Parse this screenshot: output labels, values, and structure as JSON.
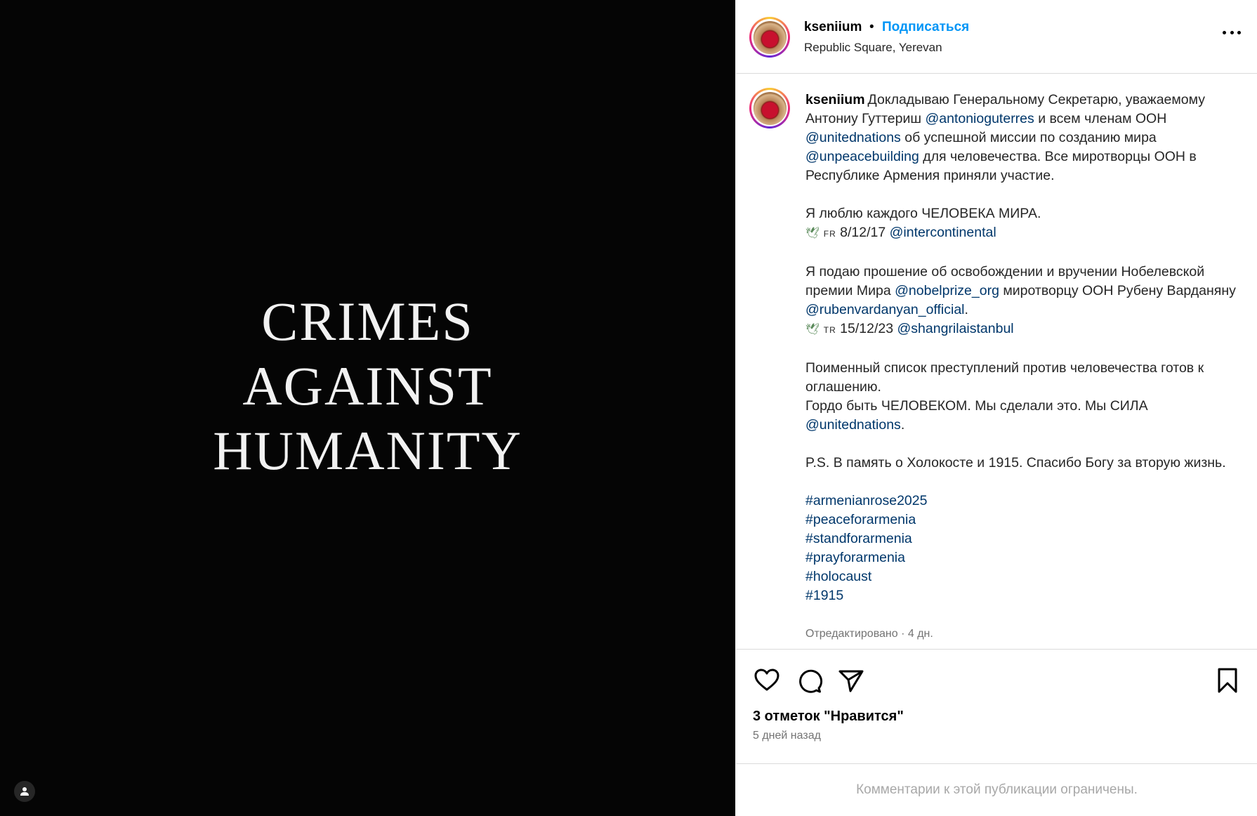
{
  "media": {
    "lines": [
      "CRIMES",
      "AGAINST",
      "HUMANITY"
    ]
  },
  "header": {
    "username": "kseniium",
    "separator": "•",
    "follow_label": "Подписаться",
    "location": "Republic Square, Yerevan"
  },
  "caption": {
    "username": "kseniium",
    "p1": [
      {
        "t": "Докладываю Генеральному Секретарю, уважаемому Антониу Гуттериш "
      },
      {
        "t": "@antonioguterres",
        "link": true
      },
      {
        "t": " и всем членам ООН "
      },
      {
        "t": "@unitednations",
        "link": true
      },
      {
        "t": " об успешной миссии по созданию мира "
      },
      {
        "t": "@unpeacebuilding",
        "link": true
      },
      {
        "t": " для человечества. Все миротворцы ООН в Республике Армения приняли участие."
      }
    ],
    "p2_line1": "Я люблю каждого ЧЕЛОВЕКА МИРА.",
    "p2_flag": "FR",
    "p2_date": " 8/12/17 ",
    "p2_link": "@intercontinental",
    "p3": [
      {
        "t": "Я подаю прошение об освобождении и вручении Нобелевской премии Мира "
      },
      {
        "t": "@nobelprize_org",
        "link": true
      },
      {
        "t": " миротворцу ООН Рубену Варданяну "
      },
      {
        "t": "@rubenvardanyan_official",
        "link": true
      },
      {
        "t": "."
      }
    ],
    "p3_flag": "TR",
    "p3_date": " 15/12/23 ",
    "p3_link": "@shangrilaistanbul",
    "p4_line1": "Поименный список преступлений против человечества готов к оглашению.",
    "p4_line2": "Гордо быть ЧЕЛОВЕКОМ. Мы сделали это. Мы СИЛА ",
    "p4_link": "@unitednations",
    "p4_end": ".",
    "p5": "P.S. В память о Холокосте и 1915. Спасибо Богу за вторую жизнь.",
    "hashtags": [
      "#armenianrose2025",
      "#peaceforarmenia",
      "#standforarmenia",
      "#prayforarmenia",
      "#holocaust",
      "#1915"
    ],
    "edited": "Отредактировано · 4 дн."
  },
  "actions": {
    "likes": "3 отметок \"Нравится\"",
    "ago": "5 дней назад"
  },
  "footer": {
    "comments_restricted": "Комментарии к этой публикации ограничены."
  }
}
